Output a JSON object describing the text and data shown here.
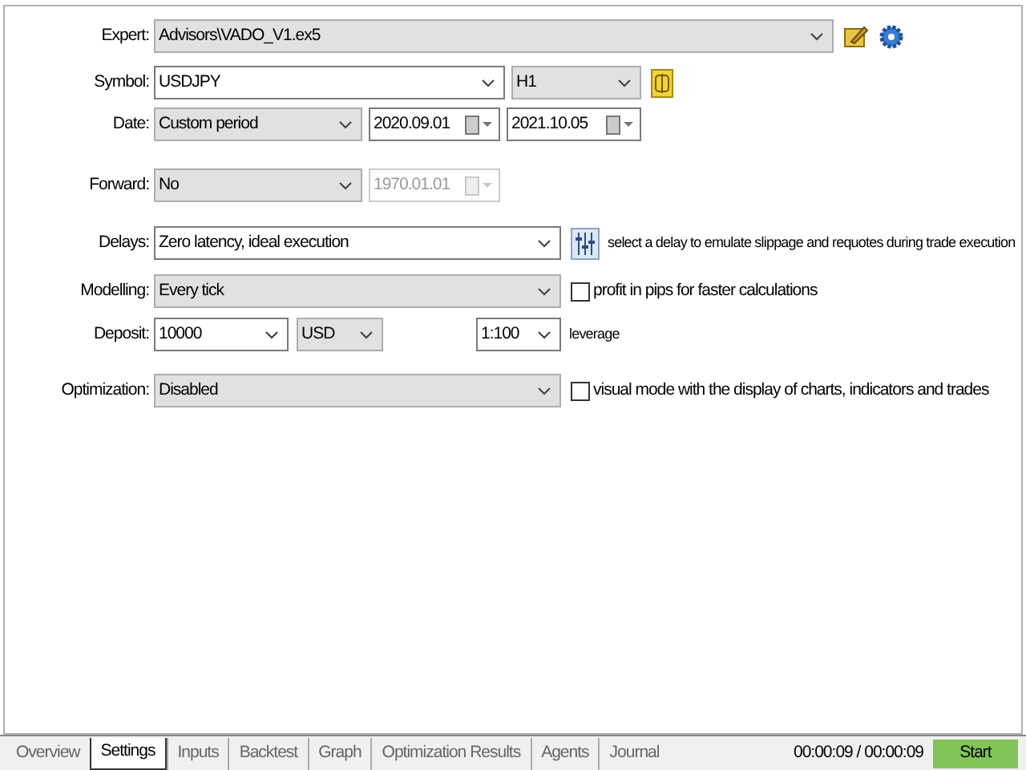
{
  "settings": [
    {
      "label": "Expert:",
      "items": [
        {
          "kind": "dropdown",
          "value": "Advisors\\VADO_V1.ex5"
        },
        {
          "kind": "icon"
        },
        {
          "kind": "icon"
        }
      ]
    },
    {
      "label": "Symbol:",
      "items": [
        {
          "kind": "combo",
          "value": "USDJPY"
        },
        {
          "kind": "dropdown",
          "value": "H1"
        },
        {
          "kind": "icon"
        }
      ]
    },
    {
      "label": "Date:",
      "items": [
        {
          "kind": "dropdown",
          "value": "Custom period"
        },
        {
          "kind": "date",
          "value": "2020.09.01",
          "disabled": false
        },
        {
          "kind": "date",
          "value": "2021.10.05",
          "disabled": false
        }
      ]
    },
    {
      "label": "Forward:",
      "items": [
        {
          "kind": "dropdown",
          "value": "No"
        },
        {
          "kind": "date",
          "value": "1970.01.01",
          "disabled": true
        }
      ]
    },
    {
      "label": "Delays:",
      "items": [
        {
          "kind": "combo",
          "value": "Zero latency, ideal execution"
        },
        {
          "kind": "icon"
        },
        {
          "kind": "text",
          "value": "select a delay to emulate slippage and requotes during trade execution"
        }
      ]
    },
    {
      "label": "Modelling:",
      "items": [
        {
          "kind": "dropdown",
          "value": "Every tick"
        },
        {
          "kind": "checkbox",
          "value": "profit in pips for faster calculations",
          "checked": false
        }
      ]
    },
    {
      "label": "Deposit:",
      "items": [
        {
          "kind": "combo",
          "value": "10000"
        },
        {
          "kind": "dropdown",
          "value": "USD"
        },
        {
          "kind": "combo",
          "value": "1:100"
        },
        {
          "kind": "text",
          "value": "leverage"
        }
      ]
    },
    {
      "label": "Optimization:",
      "items": [
        {
          "kind": "dropdown",
          "value": "Disabled"
        },
        {
          "kind": "checkbox",
          "value": "visual mode with the display of charts, indicators and trades",
          "checked": false
        }
      ]
    }
  ],
  "tabs": [
    {
      "label": "Overview",
      "selected": false
    },
    {
      "label": "Settings",
      "selected": true
    },
    {
      "label": "Inputs",
      "selected": false
    },
    {
      "label": "Backtest",
      "selected": false
    },
    {
      "label": "Graph",
      "selected": false
    },
    {
      "label": "Optimization Results",
      "selected": false
    },
    {
      "label": "Agents",
      "selected": false
    },
    {
      "label": "Journal",
      "selected": false
    }
  ],
  "timer": "00:00:09 / 00:00:09",
  "start_button": "Start"
}
